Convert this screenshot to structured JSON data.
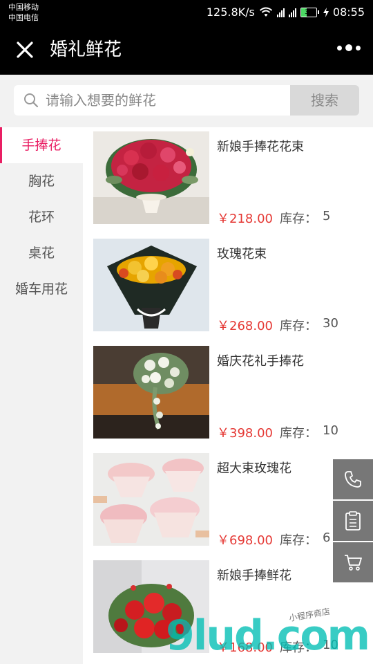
{
  "status_bar": {
    "carrier_1": "中国移动",
    "carrier_2": "中国电信",
    "net_speed": "125.8K/s",
    "battery": "38",
    "time": "08:55"
  },
  "nav": {
    "title": "婚礼鲜花"
  },
  "search": {
    "placeholder": "请输入想要的鲜花",
    "button": "搜索"
  },
  "categories": [
    {
      "label": "手捧花",
      "active": true
    },
    {
      "label": "胸花"
    },
    {
      "label": "花环"
    },
    {
      "label": "桌花"
    },
    {
      "label": "婚车用花"
    }
  ],
  "stock_label": "库存：",
  "products": [
    {
      "name": "新娘手捧花花束",
      "price": "￥218.00",
      "stock": "5"
    },
    {
      "name": "玫瑰花束",
      "price": "￥268.00",
      "stock": "30"
    },
    {
      "name": "婚庆花礼手捧花",
      "price": "￥398.00",
      "stock": "10"
    },
    {
      "name": "超大束玫瑰花",
      "price": "￥698.00",
      "stock": "6"
    },
    {
      "name": "新娘手捧鲜花",
      "price": "￥168.00",
      "stock": "10"
    }
  ],
  "float_buttons": [
    "phone-icon",
    "clipboard-icon",
    "cart-icon"
  ],
  "watermark": {
    "main": "9lud.com",
    "sub": "小程序商店"
  },
  "colors": {
    "accent": "#e91e63",
    "price": "#e53935",
    "watermark": "#00beb4"
  }
}
